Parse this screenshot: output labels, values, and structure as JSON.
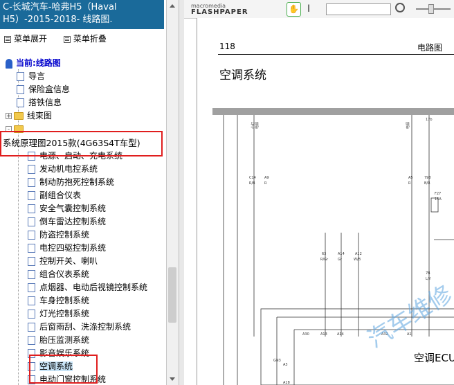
{
  "left_panel": {
    "title": "C-长城汽车-哈弗H5（Haval H5）-2015-2018- 线路图.",
    "expand_all": "菜单展开",
    "collapse_all": "菜单折叠",
    "current_label": "当前:线路图",
    "items": [
      {
        "label": "导言",
        "kind": "doc"
      },
      {
        "label": "保险盒信息",
        "kind": "doc"
      },
      {
        "label": "搭铁信息",
        "kind": "doc"
      },
      {
        "label": "线束图",
        "kind": "folder"
      },
      {
        "label": "系统原理图2015款(4G63S4T车型)",
        "kind": "folder"
      },
      {
        "label": "电源、启动、充电系统",
        "kind": "doc"
      },
      {
        "label": "发动机电控系统",
        "kind": "doc"
      },
      {
        "label": "制动防抱死控制系统",
        "kind": "doc"
      },
      {
        "label": "副组合仪表",
        "kind": "doc"
      },
      {
        "label": "安全气囊控制系统",
        "kind": "doc"
      },
      {
        "label": "倒车雷达控制系统",
        "kind": "doc"
      },
      {
        "label": "防盗控制系统",
        "kind": "doc"
      },
      {
        "label": "电控四驱控制系统",
        "kind": "doc"
      },
      {
        "label": "控制开关、喇叭",
        "kind": "doc"
      },
      {
        "label": "组合仪表系统",
        "kind": "doc"
      },
      {
        "label": "点烟器、电动后视镜控制系统",
        "kind": "doc"
      },
      {
        "label": "车身控制系统",
        "kind": "doc"
      },
      {
        "label": "灯光控制系统",
        "kind": "doc"
      },
      {
        "label": "后窗雨刮、洗涤控制系统",
        "kind": "doc"
      },
      {
        "label": "胎压监测系统",
        "kind": "doc"
      },
      {
        "label": "影音娱乐系统",
        "kind": "doc"
      },
      {
        "label": "空调系统",
        "kind": "doc"
      },
      {
        "label": "电动门窗控制系统",
        "kind": "doc"
      }
    ],
    "expander_plus": "+",
    "expander_minus": "-"
  },
  "viewer": {
    "logo_top": "macromedia",
    "logo_bottom": "FLASHPAPER",
    "page_number": "118",
    "section_header": "电路图",
    "page_title": "空调系统",
    "ecu_label": "空调ECU",
    "watermark": "汽车维修"
  },
  "diagram": {
    "top_labels": [
      "小灯",
      "电源",
      "电源",
      "17b"
    ],
    "pins_top": [
      "C14",
      "A9",
      "A5",
      "798",
      "F27"
    ],
    "wire_codes": [
      "R/B",
      "R",
      "R",
      "B/R",
      "15A"
    ],
    "mid_codes": [
      "63",
      "A14",
      "A12",
      "7B"
    ],
    "mid_colors": [
      "R/Gr",
      "Gr",
      "W/B",
      "L/Y"
    ],
    "bottom_pins": [
      "A30",
      "A13",
      "A14",
      "A32",
      "A1"
    ],
    "left_codes": [
      "GN3",
      "A3",
      "A18"
    ]
  },
  "colors": {
    "title_bg": "#1a6a9a",
    "highlight_red": "#e01e1e",
    "selected_bg": "#c8e4f7",
    "link_blue": "#0000cc"
  }
}
